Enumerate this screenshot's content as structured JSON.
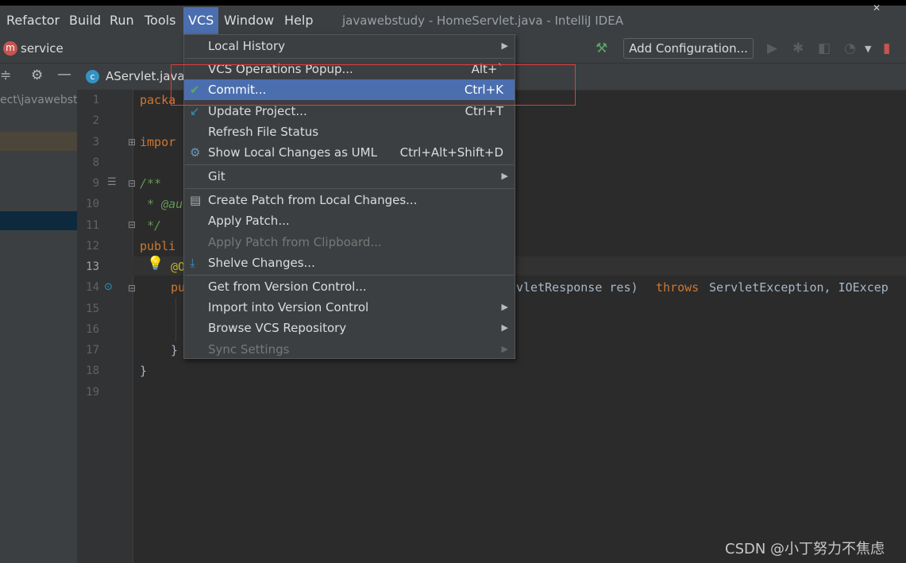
{
  "menubar": {
    "items": [
      "Refactor",
      "Build",
      "Run",
      "Tools",
      "VCS",
      "Window",
      "Help"
    ],
    "active": "VCS",
    "title": "javawebstudy - HomeServlet.java - IntelliJ IDEA"
  },
  "navbar": {
    "service_label": "service",
    "add_configuration": "Add Configuration..."
  },
  "tabs": {
    "active_tab": "AServlet.java"
  },
  "project": {
    "path_text": "ect\\javawebst"
  },
  "editor": {
    "line_numbers": [
      "1",
      "2",
      "3",
      "8",
      "9",
      "10",
      "11",
      "12",
      "13",
      "14",
      "15",
      "16",
      "17",
      "18",
      "19"
    ],
    "code": {
      "l1": "packa",
      "l3": "impor",
      "l9": "/**",
      "l10": " * @au",
      "l11": " */",
      "l12": "publi",
      "l13": "@O",
      "l14a": "pu",
      "l14b": "vletResponse res) ",
      "l14c": "throws",
      "l14d": " ServletException, IOExcep",
      "l17": "}",
      "l18": "}"
    }
  },
  "vcs_menu": {
    "items": [
      {
        "label": "Local History",
        "shortcut": "",
        "submenu": true
      },
      {
        "label": "VCS Operations Popup...",
        "shortcut": "Alt+`"
      },
      {
        "label": "Commit...",
        "shortcut": "Ctrl+K",
        "selected": true,
        "icon": "check-icon"
      },
      {
        "label": "Update Project...",
        "shortcut": "Ctrl+T",
        "icon": "update-arrow-icon"
      },
      {
        "label": "Refresh File Status",
        "shortcut": ""
      },
      {
        "label": "Show Local Changes as UML",
        "shortcut": "Ctrl+Alt+Shift+D",
        "icon": "uml-icon"
      },
      {
        "label": "Git",
        "shortcut": "",
        "submenu": true
      },
      {
        "label": "Create Patch from Local Changes...",
        "shortcut": "",
        "icon": "patch-icon"
      },
      {
        "label": "Apply Patch...",
        "shortcut": ""
      },
      {
        "label": "Apply Patch from Clipboard...",
        "shortcut": "",
        "disabled": true
      },
      {
        "label": "Shelve Changes...",
        "shortcut": "",
        "icon": "shelve-icon"
      },
      {
        "label": "Get from Version Control...",
        "shortcut": ""
      },
      {
        "label": "Import into Version Control",
        "shortcut": "",
        "submenu": true
      },
      {
        "label": "Browse VCS Repository",
        "shortcut": "",
        "submenu": true
      },
      {
        "label": "Sync Settings",
        "shortcut": "",
        "submenu": true,
        "disabled": true
      }
    ]
  },
  "watermark": "CSDN @小丁努力不焦虑",
  "colors": {
    "menu_bg": "#3c3f41",
    "selection": "#4b6eaf",
    "editor_bg": "#2b2b2b",
    "highlight_box": "#e03c3c",
    "keyword": "#cc7832",
    "comment": "#629755"
  }
}
